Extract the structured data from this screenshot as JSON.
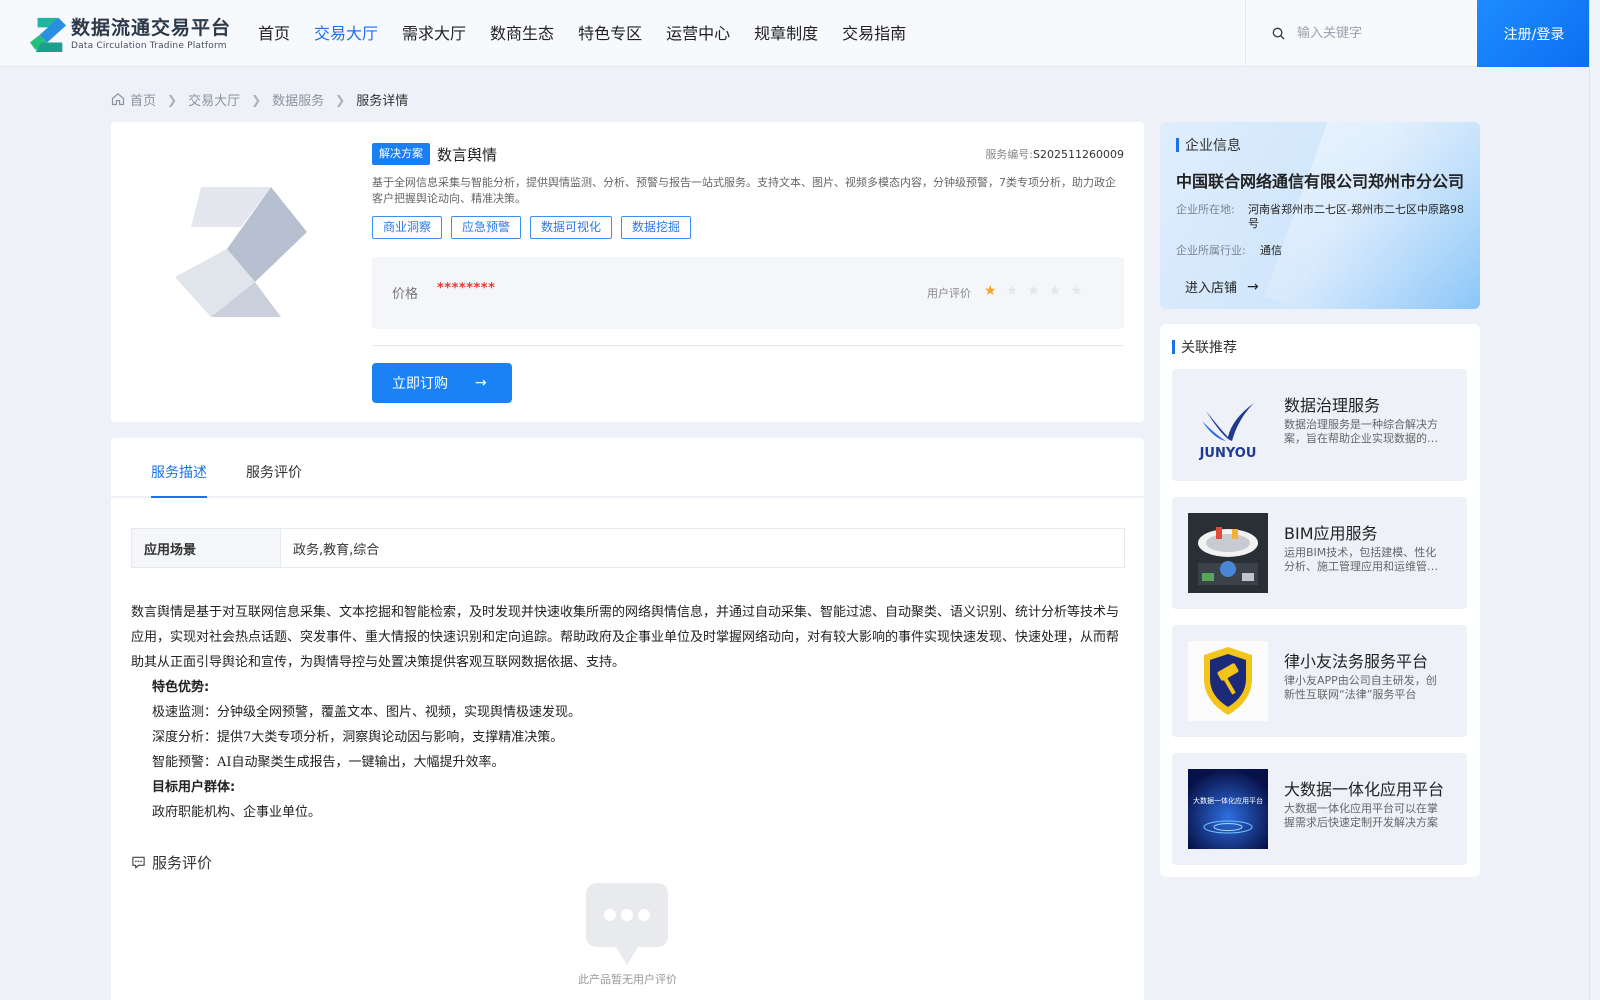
{
  "header": {
    "logo_cn": "数据流通交易平台",
    "logo_en": "Data Circulation Tradine Platform",
    "nav": [
      {
        "label": "首页",
        "active": false
      },
      {
        "label": "交易大厅",
        "active": true
      },
      {
        "label": "需求大厅",
        "active": false
      },
      {
        "label": "数商生态",
        "active": false
      },
      {
        "label": "特色专区",
        "active": false
      },
      {
        "label": "运营中心",
        "active": false
      },
      {
        "label": "规章制度",
        "active": false
      },
      {
        "label": "交易指南",
        "active": false
      }
    ],
    "search_placeholder": "输入关键字",
    "login_label": "注册/登录"
  },
  "breadcrumb": {
    "items": [
      "首页",
      "交易大厅",
      "数据服务",
      "服务详情"
    ]
  },
  "product": {
    "type_badge": "解决方案",
    "title": "数言舆情",
    "service_no_label": "服务编号:",
    "service_no": "S202511260009",
    "description": "基于全网信息采集与智能分析，提供舆情监测、分析、预警与报告一站式服务。支持文本、图片、视频多模态内容，分钟级预警，7类专项分析，助力政企客户把握舆论动向、精准决策。",
    "tags": [
      "商业洞察",
      "应急预警",
      "数据可视化",
      "数据挖掘"
    ],
    "price_label": "价格",
    "price_value": "********",
    "rating_label": "用户评价",
    "rating": 1,
    "rating_max": 5,
    "buy_label": "立即订购"
  },
  "detail": {
    "tabs": [
      {
        "label": "服务描述",
        "active": true
      },
      {
        "label": "服务评价",
        "active": false
      }
    ],
    "scene_label": "应用场景",
    "scene_value": "政务,教育,综合",
    "intro": "数言舆情是基于对互联网信息采集、文本挖掘和智能检索，及时发现并快速收集所需的网络舆情信息，并通过自动采集、智能过滤、自动聚类、语义识别、统计分析等技术与应用，实现对社会热点话题、突发事件、重大情报的快速识别和定向追踪。帮助政府及企事业单位及时掌握网络动向，对有较大影响的事件实现快速发现、快速处理，从而帮助其从正面引导舆论和宣传，为舆情导控与处置决策提供客观互联网数据依据、支持。",
    "advantages_title": "特色优势:",
    "advantages": [
      "极速监测：分钟级全网预警，覆盖文本、图片、视频，实现舆情极速发现。",
      "深度分析：提供7大类专项分析，洞察舆论动因与影响，支撑精准决策。",
      "智能预警：AI自动聚类生成报告，一键输出，大幅提升效率。"
    ],
    "users_title": "目标用户群体:",
    "users": "政府职能机构、企事业单位。",
    "review_title": "服务评价",
    "empty_text": "此产品暂无用户评价"
  },
  "company": {
    "section_title": "企业信息",
    "name": "中国联合网络通信有限公司郑州市分公司",
    "address_label": "企业所在地:",
    "address": "河南省郑州市二七区-郑州市二七区中原路98号",
    "industry_label": "企业所属行业:",
    "industry": "通信",
    "enter_label": "进入店铺"
  },
  "related": {
    "section_title": "关联推荐",
    "items": [
      {
        "title": "数据治理服务",
        "desc": "数据治理服务是一种综合解决方案，旨在帮助企业实现数据的规范化管理与应用",
        "thumb_text": "JUNYOU"
      },
      {
        "title": "BIM应用服务",
        "desc": "运用BIM技术，包括建模、性化分析、施工管理应用和运维管理等全生命周期服务",
        "thumb_text": ""
      },
      {
        "title": "律小友法务服务平台",
        "desc": "律小友APP由公司自主研发，创新性互联网“法律”服务平台",
        "thumb_text": ""
      },
      {
        "title": "大数据一体化应用平台",
        "desc": "大数据一体化应用平台可以在掌握需求后快速定制开发解决方案",
        "thumb_text": "大数据一体化应用平台"
      }
    ]
  },
  "colors": {
    "primary": "#1a73e8",
    "button": "#1a82f5",
    "price": "#e53935",
    "star_active": "#f5a623",
    "star_inactive": "#e3e6eb"
  }
}
